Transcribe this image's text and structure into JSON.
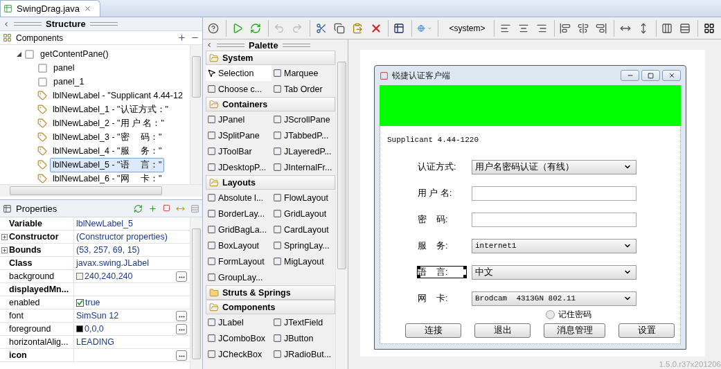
{
  "editor_tabs": [
    {
      "label": "SwingDrag.java",
      "selected": true
    }
  ],
  "structure": {
    "title": "Structure",
    "components_title": "Components",
    "tree": [
      {
        "label": "getContentPane()",
        "kind": "container",
        "expanded": true,
        "selected": false,
        "children": [
          {
            "label": "panel",
            "kind": "container",
            "selected": false
          },
          {
            "label": "panel_1",
            "kind": "container",
            "selected": false
          },
          {
            "label": "lblNewLabel - \"Supplicant 4.44-12",
            "kind": "label",
            "selected": false
          },
          {
            "label": "lblNewLabel_1 - \"认证方式：\"",
            "kind": "label",
            "selected": false
          },
          {
            "label": "lblNewLabel_2 - \"用 户 名：\"",
            "kind": "label",
            "selected": false
          },
          {
            "label": "lblNewLabel_3 - \"密　 码：\"",
            "kind": "label",
            "selected": false
          },
          {
            "label": "lblNewLabel_4 - \"服　 务：\"",
            "kind": "label",
            "selected": false
          },
          {
            "label": "lblNewLabel_5 - \"语　 言：\"",
            "kind": "label",
            "selected": true
          },
          {
            "label": "lblNewLabel_6 - \"网　 卡：\"",
            "kind": "label",
            "selected": false
          }
        ]
      }
    ]
  },
  "properties": {
    "title": "Properties",
    "rows": [
      {
        "name": "Variable",
        "value": "lblNewLabel_5",
        "kind": "text",
        "bold": true,
        "button": false
      },
      {
        "name": "Constructor",
        "value": "(Constructor properties)",
        "kind": "text",
        "bold": true,
        "button": false,
        "expanded": false
      },
      {
        "name": "Bounds",
        "value": "(53, 257, 69, 15)",
        "kind": "text",
        "bold": true,
        "button": false,
        "expanded": false
      },
      {
        "name": "Class",
        "value": "javax.swing.JLabel",
        "kind": "text",
        "bold": true,
        "button": false
      },
      {
        "name": "background",
        "value": "240,240,240",
        "kind": "color",
        "color": "#f0f0f0",
        "bold": false,
        "button": true
      },
      {
        "name": "displayedMn...",
        "kind": "text",
        "bold": true,
        "button": false
      },
      {
        "name": "enabled",
        "value": "true",
        "kind": "checkbox",
        "checked": true,
        "bold": false,
        "button": false
      },
      {
        "name": "font",
        "value": "SimSun 12",
        "kind": "text",
        "bold": false,
        "button": true
      },
      {
        "name": "foreground",
        "value": "0,0,0",
        "kind": "color",
        "color": "#000000",
        "bold": false,
        "button": true
      },
      {
        "name": "horizontalAlig...",
        "value": "LEADING",
        "kind": "text",
        "bold": false,
        "button": false
      },
      {
        "name": "icon",
        "kind": "text",
        "bold": true,
        "button": true
      }
    ]
  },
  "toolbar": {
    "look_and_feel": "<system>"
  },
  "palette": {
    "title": "Palette",
    "groups": [
      {
        "label": "System",
        "expanded": true,
        "items": [
          {
            "label": "Selection",
            "selected": true
          },
          {
            "label": "Marquee",
            "selected": false
          },
          {
            "label": "Choose c...",
            "selected": false
          },
          {
            "label": "Tab Order",
            "selected": false
          }
        ]
      },
      {
        "label": "Containers",
        "expanded": true,
        "items": [
          {
            "label": "JPanel",
            "selected": false
          },
          {
            "label": "JScrollPane",
            "selected": false
          },
          {
            "label": "JSplitPane",
            "selected": false
          },
          {
            "label": "JTabbedP...",
            "selected": false
          },
          {
            "label": "JToolBar",
            "selected": false
          },
          {
            "label": "JLayeredP...",
            "selected": false
          },
          {
            "label": "JDesktopP...",
            "selected": false
          },
          {
            "label": "JInternalFr...",
            "selected": false
          }
        ]
      },
      {
        "label": "Layouts",
        "expanded": true,
        "items": [
          {
            "label": "Absolute l...",
            "selected": false
          },
          {
            "label": "FlowLayout",
            "selected": false
          },
          {
            "label": "BorderLay...",
            "selected": false
          },
          {
            "label": "GridLayout",
            "selected": false
          },
          {
            "label": "GridBagLa...",
            "selected": false
          },
          {
            "label": "CardLayout",
            "selected": false
          },
          {
            "label": "BoxLayout",
            "selected": false
          },
          {
            "label": "SpringLay...",
            "selected": false
          },
          {
            "label": "FormLayout",
            "selected": false
          },
          {
            "label": "MigLayout",
            "selected": false
          },
          {
            "label": "GroupLay...",
            "selected": false
          }
        ]
      },
      {
        "label": "Struts & Springs",
        "expanded": false
      },
      {
        "label": "Components",
        "expanded": true,
        "items": [
          {
            "label": "JLabel",
            "selected": false
          },
          {
            "label": "JTextField",
            "selected": false
          },
          {
            "label": "JComboBox",
            "selected": false
          },
          {
            "label": "JButton",
            "selected": false
          },
          {
            "label": "JCheckBox",
            "selected": false
          },
          {
            "label": "JRadioBut...",
            "selected": false
          }
        ]
      }
    ]
  },
  "design": {
    "window_title": "锐捷认证客户端",
    "version_label": "Supplicant 4.44-1220",
    "rows": [
      {
        "label": "认证方式:",
        "kind": "combo",
        "value": "用户名密码认证（有线）",
        "selected": false
      },
      {
        "label": "用 户 名:",
        "kind": "text",
        "selected": false
      },
      {
        "label": "密    码:",
        "kind": "text",
        "selected": false
      },
      {
        "label": "服    务:",
        "kind": "combo",
        "value": "internet1",
        "selected": false
      },
      {
        "label": "语    言:",
        "kind": "combo",
        "value": "中文",
        "selected": true
      },
      {
        "label": "网    卡:",
        "kind": "combo",
        "value": "Brodcam  4313GN 802.11",
        "selected": false
      }
    ],
    "remember": {
      "label": "记住密码",
      "selected": false
    },
    "buttons": [
      "连接",
      "退出",
      "消息管理",
      "设置"
    ]
  },
  "version": "1.5.0.r37x201206"
}
